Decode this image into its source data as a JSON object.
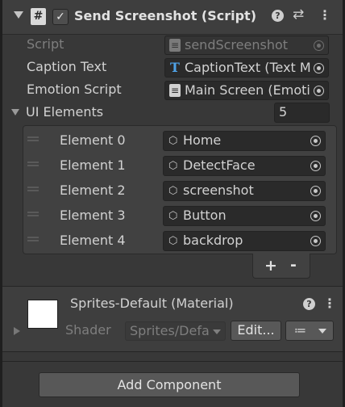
{
  "component": {
    "title": "Send Screenshot (Script)",
    "enabled": true,
    "script_icon_glyph": "#",
    "icons": [
      "fold-arrow-icon",
      "script-icon",
      "checkbox-icon",
      "help-icon",
      "preset-icon",
      "context-menu-icon"
    ]
  },
  "fields": {
    "script": {
      "label": "Script",
      "value": "sendScreenshot",
      "icon": "script-icon",
      "disabled": true
    },
    "caption_text": {
      "label": "Caption Text",
      "value": "CaptionText (Text M",
      "icon": "text-component-icon",
      "icon_glyph": "T"
    },
    "emotion_script": {
      "label": "Emotion Script",
      "value": "Main Screen (Emoti",
      "icon": "script-icon"
    }
  },
  "ui_elements": {
    "label": "UI Elements",
    "size": "5",
    "items": [
      {
        "label": "Element 0",
        "value": "Home"
      },
      {
        "label": "Element 1",
        "value": "DetectFace"
      },
      {
        "label": "Element 2",
        "value": "screenshot"
      },
      {
        "label": "Element 3",
        "value": "Button"
      },
      {
        "label": "Element 4",
        "value": "backdrop"
      }
    ],
    "add_label": "+",
    "remove_label": "-"
  },
  "material": {
    "title": "Sprites-Default (Material)",
    "swatch_color": "#ffffff",
    "shader_label": "Shader",
    "shader_value": "Sprites/Defa",
    "edit_label": "Edit...",
    "list_glyph": "≔"
  },
  "add_component_label": "Add Component",
  "colors": {
    "background": "#383838",
    "header": "#3e3e3e",
    "field": "#2a2a2a",
    "button": "#585858",
    "text_icon_blue": "#4fa3e8"
  }
}
